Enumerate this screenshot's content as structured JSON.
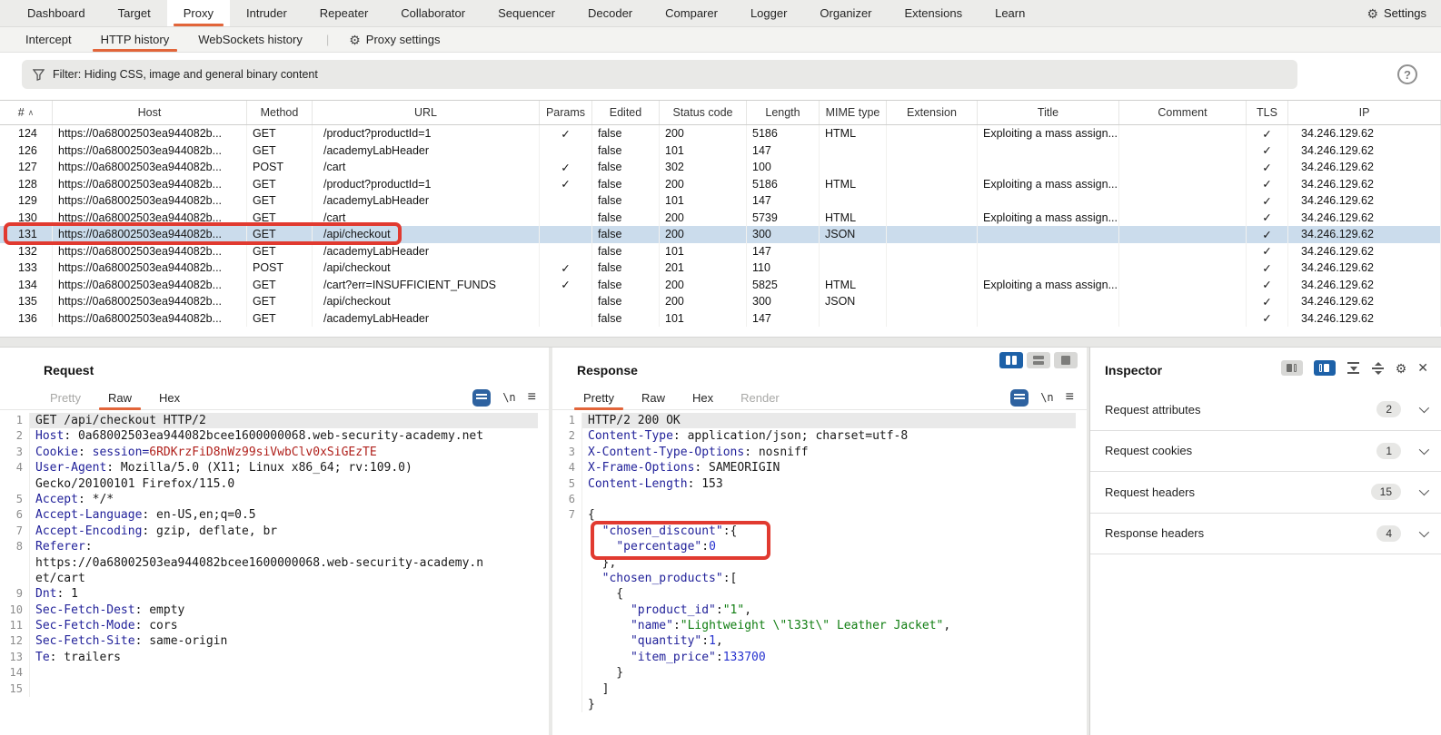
{
  "icons": {
    "gear": "⚙",
    "check": "✓",
    "close": "✕",
    "hamburger": "≡",
    "newline": "\\n",
    "help": "?",
    "sort_asc": "∧",
    "divider": "|"
  },
  "topbar": {
    "tabs": [
      "Dashboard",
      "Target",
      "Proxy",
      "Intruder",
      "Repeater",
      "Collaborator",
      "Sequencer",
      "Decoder",
      "Comparer",
      "Logger",
      "Organizer",
      "Extensions",
      "Learn"
    ],
    "active_tab": "Proxy",
    "settings_label": "Settings"
  },
  "subbar": {
    "tabs": [
      "Intercept",
      "HTTP history",
      "WebSockets history"
    ],
    "active_tab": "HTTP history",
    "proxy_settings_label": "Proxy settings"
  },
  "filter": {
    "label": "Filter: Hiding CSS, image and general binary content"
  },
  "history_table": {
    "columns": [
      "#",
      "Host",
      "Method",
      "URL",
      "Params",
      "Edited",
      "Status code",
      "Length",
      "MIME type",
      "Extension",
      "Title",
      "Comment",
      "TLS",
      "IP"
    ],
    "rows": [
      {
        "num": "124",
        "host": "https://0a68002503ea944082b...",
        "method": "GET",
        "url": "/product?productId=1",
        "params": true,
        "edited": false,
        "status": "200",
        "length": "5186",
        "mime": "HTML",
        "extension": "",
        "title": "Exploiting a mass assign...",
        "comment": "",
        "tls": true,
        "ip": "34.246.129.62",
        "selected": false
      },
      {
        "num": "126",
        "host": "https://0a68002503ea944082b...",
        "method": "GET",
        "url": "/academyLabHeader",
        "params": false,
        "edited": false,
        "status": "101",
        "length": "147",
        "mime": "",
        "extension": "",
        "title": "",
        "comment": "",
        "tls": true,
        "ip": "34.246.129.62",
        "selected": false
      },
      {
        "num": "127",
        "host": "https://0a68002503ea944082b...",
        "method": "POST",
        "url": "/cart",
        "params": true,
        "edited": false,
        "status": "302",
        "length": "100",
        "mime": "",
        "extension": "",
        "title": "",
        "comment": "",
        "tls": true,
        "ip": "34.246.129.62",
        "selected": false
      },
      {
        "num": "128",
        "host": "https://0a68002503ea944082b...",
        "method": "GET",
        "url": "/product?productId=1",
        "params": true,
        "edited": false,
        "status": "200",
        "length": "5186",
        "mime": "HTML",
        "extension": "",
        "title": "Exploiting a mass assign...",
        "comment": "",
        "tls": true,
        "ip": "34.246.129.62",
        "selected": false
      },
      {
        "num": "129",
        "host": "https://0a68002503ea944082b...",
        "method": "GET",
        "url": "/academyLabHeader",
        "params": false,
        "edited": false,
        "status": "101",
        "length": "147",
        "mime": "",
        "extension": "",
        "title": "",
        "comment": "",
        "tls": true,
        "ip": "34.246.129.62",
        "selected": false
      },
      {
        "num": "130",
        "host": "https://0a68002503ea944082b...",
        "method": "GET",
        "url": "/cart",
        "params": false,
        "edited": false,
        "status": "200",
        "length": "5739",
        "mime": "HTML",
        "extension": "",
        "title": "Exploiting a mass assign...",
        "comment": "",
        "tls": true,
        "ip": "34.246.129.62",
        "selected": false
      },
      {
        "num": "131",
        "host": "https://0a68002503ea944082b...",
        "method": "GET",
        "url": "/api/checkout",
        "params": false,
        "edited": false,
        "status": "200",
        "length": "300",
        "mime": "JSON",
        "extension": "",
        "title": "",
        "comment": "",
        "tls": true,
        "ip": "34.246.129.62",
        "selected": true
      },
      {
        "num": "132",
        "host": "https://0a68002503ea944082b...",
        "method": "GET",
        "url": "/academyLabHeader",
        "params": false,
        "edited": false,
        "status": "101",
        "length": "147",
        "mime": "",
        "extension": "",
        "title": "",
        "comment": "",
        "tls": true,
        "ip": "34.246.129.62",
        "selected": false
      },
      {
        "num": "133",
        "host": "https://0a68002503ea944082b...",
        "method": "POST",
        "url": "/api/checkout",
        "params": true,
        "edited": false,
        "status": "201",
        "length": "110",
        "mime": "",
        "extension": "",
        "title": "",
        "comment": "",
        "tls": true,
        "ip": "34.246.129.62",
        "selected": false
      },
      {
        "num": "134",
        "host": "https://0a68002503ea944082b...",
        "method": "GET",
        "url": "/cart?err=INSUFFICIENT_FUNDS",
        "params": true,
        "edited": false,
        "status": "200",
        "length": "5825",
        "mime": "HTML",
        "extension": "",
        "title": "Exploiting a mass assign...",
        "comment": "",
        "tls": true,
        "ip": "34.246.129.62",
        "selected": false
      },
      {
        "num": "135",
        "host": "https://0a68002503ea944082b...",
        "method": "GET",
        "url": "/api/checkout",
        "params": false,
        "edited": false,
        "status": "200",
        "length": "300",
        "mime": "JSON",
        "extension": "",
        "title": "",
        "comment": "",
        "tls": true,
        "ip": "34.246.129.62",
        "selected": false
      },
      {
        "num": "136",
        "host": "https://0a68002503ea944082b...",
        "method": "GET",
        "url": "/academyLabHeader",
        "params": false,
        "edited": false,
        "status": "101",
        "length": "147",
        "mime": "",
        "extension": "",
        "title": "",
        "comment": "",
        "tls": true,
        "ip": "34.246.129.62",
        "selected": false
      }
    ]
  },
  "request_panel": {
    "title": "Request",
    "tabs": [
      {
        "label": "Pretty",
        "state": "disabled"
      },
      {
        "label": "Raw",
        "state": "active"
      },
      {
        "label": "Hex",
        "state": "normal"
      }
    ],
    "lines": [
      {
        "n": "1",
        "hl": true,
        "segs": [
          [
            "p",
            "GET /api/checkout HTTP/2"
          ]
        ]
      },
      {
        "n": "2",
        "segs": [
          [
            "h",
            "Host"
          ],
          [
            "p",
            ": 0a68002503ea944082bcee1600000068.web-security-academy.net"
          ]
        ]
      },
      {
        "n": "3",
        "segs": [
          [
            "h",
            "Cookie"
          ],
          [
            "p",
            ": "
          ],
          [
            "h",
            "session="
          ],
          [
            "r",
            "6RDKrzFiD8nWz99siVwbClv0xSiGEzTE"
          ]
        ]
      },
      {
        "n": "4",
        "segs": [
          [
            "h",
            "User-Agent"
          ],
          [
            "p",
            ": Mozilla/5.0 (X11; Linux x86_64; rv:109.0)"
          ]
        ]
      },
      {
        "n": "",
        "segs": [
          [
            "p",
            "Gecko/20100101 Firefox/115.0"
          ]
        ]
      },
      {
        "n": "5",
        "segs": [
          [
            "h",
            "Accept"
          ],
          [
            "p",
            ": */*"
          ]
        ]
      },
      {
        "n": "6",
        "segs": [
          [
            "h",
            "Accept-Language"
          ],
          [
            "p",
            ": en-US,en;q=0.5"
          ]
        ]
      },
      {
        "n": "7",
        "segs": [
          [
            "h",
            "Accept-Encoding"
          ],
          [
            "p",
            ": gzip, deflate, br"
          ]
        ]
      },
      {
        "n": "8",
        "segs": [
          [
            "h",
            "Referer"
          ],
          [
            "p",
            ":"
          ]
        ]
      },
      {
        "n": "",
        "segs": [
          [
            "p",
            "https://0a68002503ea944082bcee1600000068.web-security-academy.n"
          ]
        ]
      },
      {
        "n": "",
        "segs": [
          [
            "p",
            "et/cart"
          ]
        ]
      },
      {
        "n": "9",
        "segs": [
          [
            "h",
            "Dnt"
          ],
          [
            "p",
            ": 1"
          ]
        ]
      },
      {
        "n": "10",
        "segs": [
          [
            "h",
            "Sec-Fetch-Dest"
          ],
          [
            "p",
            ": empty"
          ]
        ]
      },
      {
        "n": "11",
        "segs": [
          [
            "h",
            "Sec-Fetch-Mode"
          ],
          [
            "p",
            ": cors"
          ]
        ]
      },
      {
        "n": "12",
        "segs": [
          [
            "h",
            "Sec-Fetch-Site"
          ],
          [
            "p",
            ": same-origin"
          ]
        ]
      },
      {
        "n": "13",
        "segs": [
          [
            "h",
            "Te"
          ],
          [
            "p",
            ": trailers"
          ]
        ]
      },
      {
        "n": "14",
        "segs": []
      },
      {
        "n": "15",
        "segs": []
      }
    ]
  },
  "response_panel": {
    "title": "Response",
    "tabs": [
      {
        "label": "Pretty",
        "state": "active"
      },
      {
        "label": "Raw",
        "state": "normal"
      },
      {
        "label": "Hex",
        "state": "normal"
      },
      {
        "label": "Render",
        "state": "disabled"
      }
    ],
    "lines": [
      {
        "n": "1",
        "hl": true,
        "segs": [
          [
            "p",
            "HTTP/2 200 OK"
          ]
        ]
      },
      {
        "n": "2",
        "segs": [
          [
            "h",
            "Content-Type"
          ],
          [
            "p",
            ": application/json; charset=utf-8"
          ]
        ]
      },
      {
        "n": "3",
        "segs": [
          [
            "h",
            "X-Content-Type-Options"
          ],
          [
            "p",
            ": nosniff"
          ]
        ]
      },
      {
        "n": "4",
        "segs": [
          [
            "h",
            "X-Frame-Options"
          ],
          [
            "p",
            ": SAMEORIGIN"
          ]
        ]
      },
      {
        "n": "5",
        "segs": [
          [
            "h",
            "Content-Length"
          ],
          [
            "p",
            ": 153"
          ]
        ]
      },
      {
        "n": "6",
        "segs": []
      },
      {
        "n": "7",
        "segs": [
          [
            "p",
            "{"
          ]
        ]
      },
      {
        "n": "",
        "segs": [
          [
            "p",
            "  "
          ],
          [
            "h",
            "\"chosen_discount\""
          ],
          [
            "p",
            ":{"
          ]
        ]
      },
      {
        "n": "",
        "segs": [
          [
            "p",
            "    "
          ],
          [
            "h",
            "\"percentage\""
          ],
          [
            "p",
            ":"
          ],
          [
            "b",
            "0"
          ]
        ]
      },
      {
        "n": "",
        "segs": [
          [
            "p",
            "  },"
          ]
        ]
      },
      {
        "n": "",
        "segs": [
          [
            "p",
            "  "
          ],
          [
            "h",
            "\"chosen_products\""
          ],
          [
            "p",
            ":["
          ]
        ]
      },
      {
        "n": "",
        "segs": [
          [
            "p",
            "    {"
          ]
        ]
      },
      {
        "n": "",
        "segs": [
          [
            "p",
            "      "
          ],
          [
            "h",
            "\"product_id\""
          ],
          [
            "p",
            ":"
          ],
          [
            "g",
            "\"1\""
          ],
          [
            "p",
            ","
          ]
        ]
      },
      {
        "n": "",
        "segs": [
          [
            "p",
            "      "
          ],
          [
            "h",
            "\"name\""
          ],
          [
            "p",
            ":"
          ],
          [
            "g",
            "\"Lightweight \\\"l33t\\\" Leather Jacket\""
          ],
          [
            "p",
            ","
          ]
        ]
      },
      {
        "n": "",
        "segs": [
          [
            "p",
            "      "
          ],
          [
            "h",
            "\"quantity\""
          ],
          [
            "p",
            ":"
          ],
          [
            "b",
            "1"
          ],
          [
            "p",
            ","
          ]
        ]
      },
      {
        "n": "",
        "segs": [
          [
            "p",
            "      "
          ],
          [
            "h",
            "\"item_price\""
          ],
          [
            "p",
            ":"
          ],
          [
            "b",
            "133700"
          ]
        ]
      },
      {
        "n": "",
        "segs": [
          [
            "p",
            "    }"
          ]
        ]
      },
      {
        "n": "",
        "segs": [
          [
            "p",
            "  ]"
          ]
        ]
      },
      {
        "n": "",
        "segs": [
          [
            "p",
            "}"
          ]
        ]
      }
    ]
  },
  "inspector": {
    "title": "Inspector",
    "sections": [
      {
        "label": "Request attributes",
        "count": "2"
      },
      {
        "label": "Request cookies",
        "count": "1"
      },
      {
        "label": "Request headers",
        "count": "15"
      },
      {
        "label": "Response headers",
        "count": "4"
      }
    ]
  }
}
